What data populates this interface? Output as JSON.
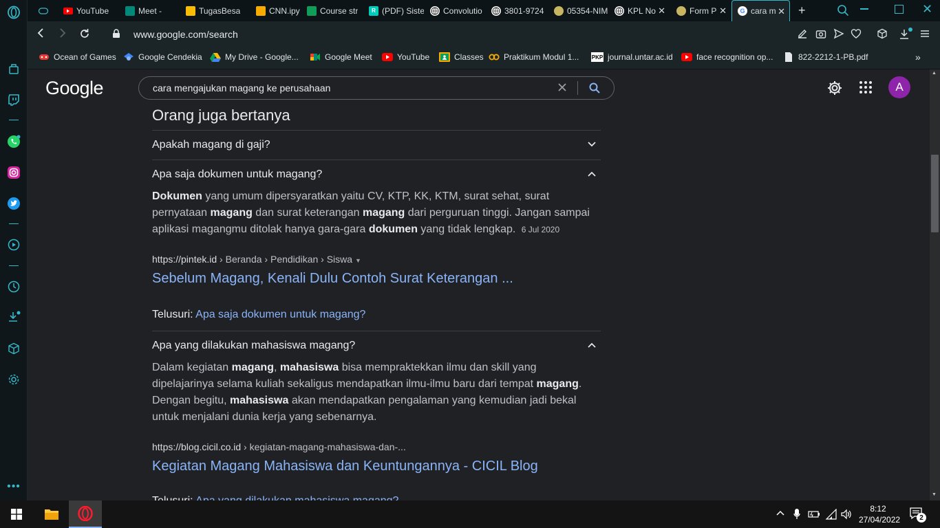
{
  "tabs": [
    {
      "label": "",
      "icon": "gamepad-icon",
      "color": "#35b8c8"
    },
    {
      "label": "YouTube",
      "icon": "youtube-icon",
      "color": "#ff0000"
    },
    {
      "label": "Meet -",
      "icon": "meet-icon",
      "color": "#00897b"
    },
    {
      "label": "TugasBesa",
      "icon": "drive-icon",
      "color": "#fbbc04"
    },
    {
      "label": "CNN.ipynb",
      "icon": "colab-icon",
      "color": "#f9ab00"
    },
    {
      "label": "Course str",
      "icon": "classroom-icon",
      "color": "#0f9d58"
    },
    {
      "label": "(PDF) Siste",
      "icon": "researchgate-icon",
      "color": "#00ccbb"
    },
    {
      "label": "Convolutio",
      "icon": "globe-icon",
      "color": "#4a6fa5"
    },
    {
      "label": "3801-9724",
      "icon": "globe-icon",
      "color": "#ffffff"
    },
    {
      "label": "05354-NIM",
      "icon": "university-icon",
      "color": "#c8b560"
    },
    {
      "label": "KPL No",
      "icon": "globe-icon",
      "color": "#ffffff"
    },
    {
      "label": "Form P",
      "icon": "university-icon",
      "color": "#c8b560"
    },
    {
      "label": "cara m",
      "icon": "google-icon",
      "color": "#4285f4"
    }
  ],
  "address": {
    "url": "www.google.com/search"
  },
  "bookmarks": [
    {
      "label": "Ocean of Games",
      "icon": "gamepad-icon"
    },
    {
      "label": "Google Cendekia",
      "icon": "scholar-icon"
    },
    {
      "label": "My Drive - Google...",
      "icon": "drive-icon"
    },
    {
      "label": "Google Meet",
      "icon": "meet-icon"
    },
    {
      "label": "YouTube",
      "icon": "youtube-icon"
    },
    {
      "label": "Classes",
      "icon": "classroom-icon"
    },
    {
      "label": "Praktikum Modul 1...",
      "icon": "colab-icon"
    },
    {
      "label": "journal.untar.ac.id",
      "icon": "pkp-icon",
      "badge": "PKP"
    },
    {
      "label": "face recognition op...",
      "icon": "youtube-icon"
    },
    {
      "label": "822-2212-1-PB.pdf",
      "icon": "file-icon"
    }
  ],
  "google": {
    "logo": "Google",
    "query": "cara mengajukan magang ke perusahaan",
    "avatar": "A"
  },
  "paa": {
    "title": "Orang juga bertanya",
    "q1": "Apakah magang di gaji?",
    "q2": "Apa saja dokumen untuk magang?",
    "a2": [
      {
        "t": "Dokumen",
        "b": true
      },
      {
        "t": " yang umum dipersyaratkan yaitu CV, KTP, KK, KTM, surat sehat, surat pernyataan ",
        "b": false
      },
      {
        "t": "magang",
        "b": true
      },
      {
        "t": " dan surat keterangan ",
        "b": false
      },
      {
        "t": "magang",
        "b": true
      },
      {
        "t": " dari perguruan tinggi. Jangan sampai aplikasi magangmu ditolak hanya gara-gara ",
        "b": false
      },
      {
        "t": "dokumen",
        "b": true
      },
      {
        "t": " yang tidak lengkap.",
        "b": false
      }
    ],
    "a2_date": "6 Jul 2020",
    "r2_domain": "https://pintek.id",
    "r2_path": " › Beranda › Pendidikan › Siswa",
    "r2_title": "Sebelum Magang, Kenali Dulu Contoh Surat Keterangan ...",
    "telusuri_label": "Telusuri: ",
    "t2": "Apa saja dokumen untuk magang?",
    "q3": "Apa yang dilakukan mahasiswa magang?",
    "a3": [
      {
        "t": "Dalam kegiatan ",
        "b": false
      },
      {
        "t": "magang",
        "b": true
      },
      {
        "t": ", ",
        "b": false
      },
      {
        "t": "mahasiswa",
        "b": true
      },
      {
        "t": " bisa mempraktekkan ilmu dan skill yang dipelajarinya selama kuliah sekaligus mendapatkan ilmu-ilmu baru dari tempat ",
        "b": false
      },
      {
        "t": "magang",
        "b": true
      },
      {
        "t": ". Dengan begitu, ",
        "b": false
      },
      {
        "t": "mahasiswa",
        "b": true
      },
      {
        "t": " akan mendapatkan pengalaman yang kemudian jadi bekal untuk menjalani dunia kerja yang sebenarnya.",
        "b": false
      }
    ],
    "r3_domain": "https://blog.cicil.co.id",
    "r3_path": " › kegiatan-magang-mahasiswa-dan-...",
    "r3_title": "Kegiatan Magang Mahasiswa dan Keuntungannya - CICIL Blog",
    "t3": "Apa yang dilakukan mahasiswa magang?"
  },
  "taskbar": {
    "time": "8:12",
    "date": "27/04/2022",
    "notifications": "2"
  }
}
